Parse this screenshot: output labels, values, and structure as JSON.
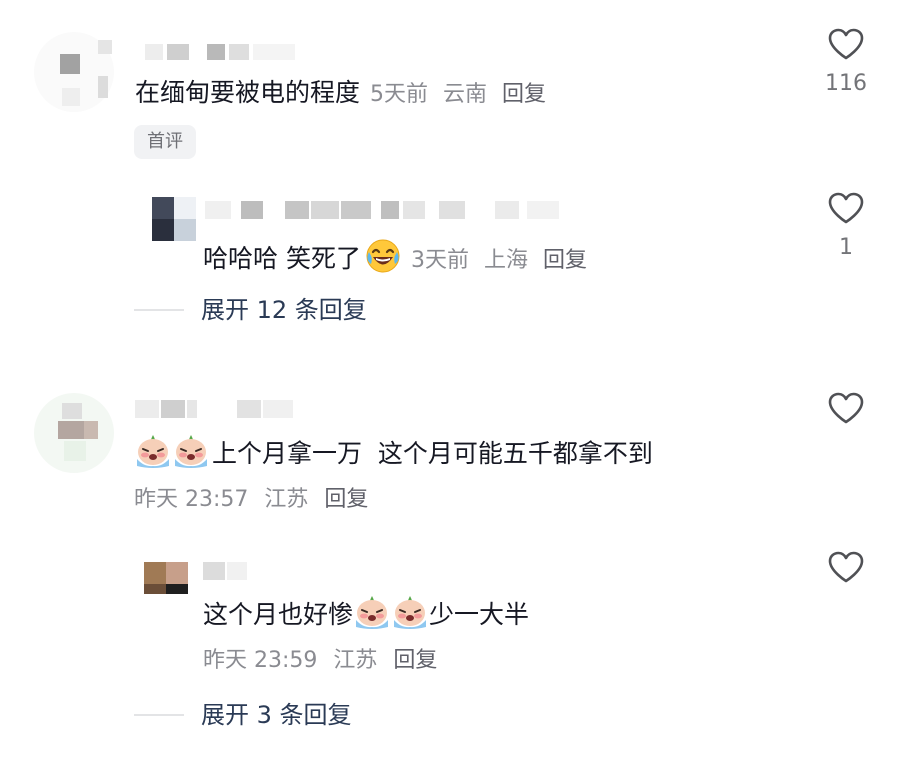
{
  "comments": [
    {
      "text": "在缅甸要被电的程度",
      "time": "5天前",
      "location": "云南",
      "reply_label": "回复",
      "badge": "首评",
      "likes": "116",
      "replies": [
        {
          "text": "哈哈哈 笑死了",
          "emoji": "laughing-tears-emoji",
          "time": "3天前",
          "location": "上海",
          "reply_label": "回复",
          "likes": "1"
        }
      ],
      "expand_label": "展开 12 条回复"
    },
    {
      "text_prefix_emojis": [
        "crying-baby-emoji",
        "crying-baby-emoji"
      ],
      "text": "上个月拿一万  这个月可能五千都拿不到",
      "time": "昨天 23:57",
      "location": "江苏",
      "reply_label": "回复",
      "likes": "",
      "replies": [
        {
          "text_before": "这个月也好惨",
          "inline_emojis": [
            "crying-baby-emoji",
            "crying-baby-emoji"
          ],
          "text_after": "少一大半",
          "time": "昨天 23:59",
          "location": "江苏",
          "reply_label": "回复",
          "likes": ""
        }
      ],
      "expand_label": "展开 3 条回复"
    }
  ],
  "colors": {
    "text": "#161823",
    "meta": "#8a8b91",
    "expand": "#2a3a55",
    "heart_stroke": "#505155"
  }
}
